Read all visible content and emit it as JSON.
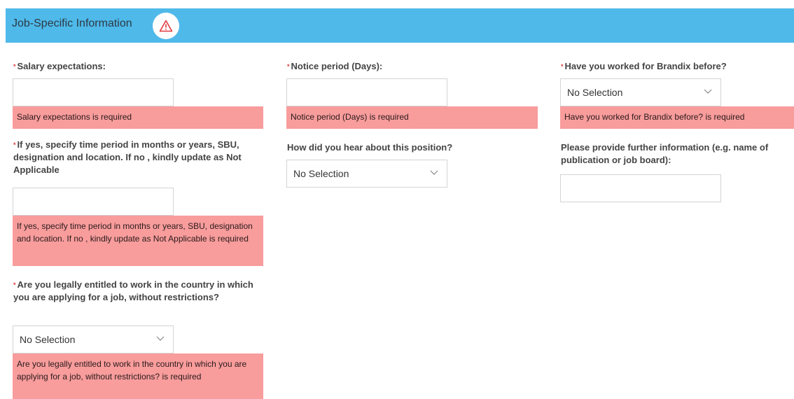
{
  "section": {
    "title": "Job-Specific Information",
    "warning_icon": "warning-triangle-icon"
  },
  "colors": {
    "header_bg": "#4fb9ea",
    "error_bg": "#f89c9c",
    "required_star": "#e0393e",
    "warning_icon": "#e0393e"
  },
  "required_marker": "*",
  "fields": {
    "salary": {
      "label": "Salary expectations:",
      "value": "",
      "error": "Salary expectations is required"
    },
    "notice": {
      "label": "Notice period (Days):",
      "value": "",
      "error": "Notice period (Days) is required"
    },
    "worked_before": {
      "label": "Have you worked for Brandix before?",
      "selected": "No Selection",
      "error": "Have you worked for Brandix before? is required"
    },
    "specify": {
      "label": "If yes, specify time period in months or years, SBU, designation and location. If no , kindly update as Not Applicable",
      "value": "",
      "error": "If yes, specify time period in months or years, SBU, designation and location. If no , kindly update as Not Applicable is required"
    },
    "hear_about": {
      "label": "How did you hear about this position?",
      "selected": "No Selection"
    },
    "further_info": {
      "label": "Please provide further information (e.g. name of publication or job board):",
      "value": ""
    },
    "legally_entitled": {
      "label": "Are you legally entitled to work in the country in which you are applying for a job, without restrictions?",
      "selected": "No Selection",
      "error": "Are you legally entitled to work in the country in which you are applying for a job, without restrictions? is required"
    }
  }
}
